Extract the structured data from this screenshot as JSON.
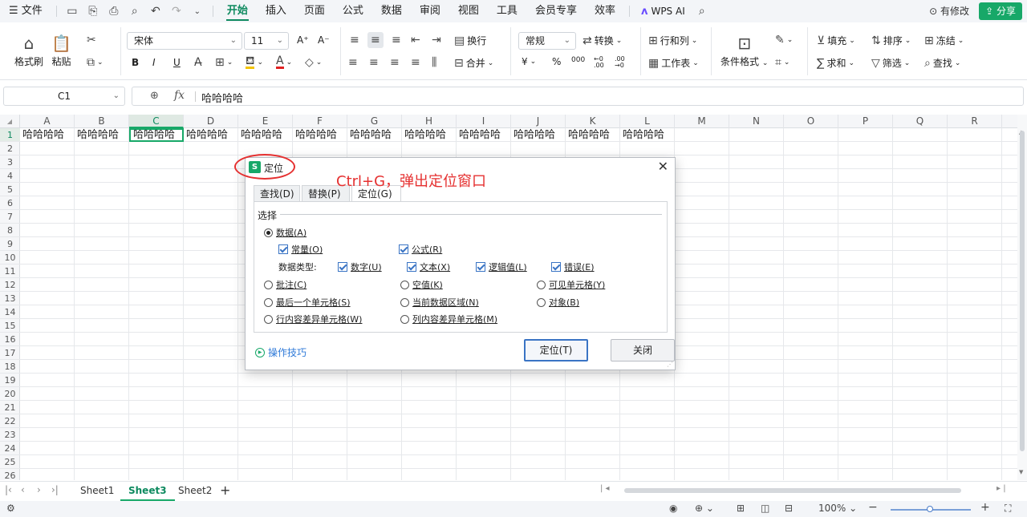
{
  "menubar": {
    "file": "文件",
    "tabs": [
      "开始",
      "插入",
      "页面",
      "公式",
      "数据",
      "审阅",
      "视图",
      "工具",
      "会员专享",
      "效率"
    ],
    "active_tab": "开始",
    "wps_ai": "WPS AI",
    "has_changes": "有修改",
    "share": "分享"
  },
  "ribbon": {
    "format_painter": "格式刷",
    "paste": "粘贴",
    "font_name": "宋体",
    "font_size": "11",
    "wrap": "换行",
    "merge": "合并",
    "number_format": "常规",
    "convert": "转换",
    "percent": "%",
    "row_col": "行和列",
    "worksheet": "工作表",
    "cond_format": "条件格式",
    "fill": "填充",
    "sort": "排序",
    "freeze": "冻结",
    "sum": "求和",
    "filter": "筛选",
    "find": "查找",
    "bold": "B",
    "italic": "I",
    "underline": "U",
    "font_grow": "A⁺",
    "font_shrink": "A⁻",
    "thousands": "000",
    "dec_inc": "←0 .00",
    "dec_dec": ".00 →0",
    "currency": "¥"
  },
  "formula_bar": {
    "cell_ref": "C1",
    "fx": "fx",
    "value": "哈哈哈哈"
  },
  "sheet": {
    "columns": [
      "A",
      "B",
      "C",
      "D",
      "E",
      "F",
      "G",
      "H",
      "I",
      "J",
      "K",
      "L",
      "M",
      "N",
      "O",
      "P",
      "Q",
      "R"
    ],
    "selected_column": "C",
    "rows": [
      "1",
      "2",
      "3",
      "4",
      "5",
      "6",
      "7",
      "8",
      "9",
      "10",
      "11",
      "12",
      "13",
      "14",
      "15",
      "16",
      "17",
      "18",
      "19",
      "20",
      "21",
      "22",
      "23",
      "24",
      "25",
      "26"
    ],
    "row1_values": [
      "哈哈哈哈",
      "哈哈哈哈",
      "哈哈哈哈",
      "哈哈哈哈",
      "哈哈哈哈",
      "哈哈哈哈",
      "哈哈哈哈",
      "哈哈哈哈",
      "哈哈哈哈",
      "哈哈哈哈",
      "哈哈哈哈",
      "哈哈哈哈"
    ],
    "active_cell_index": 2
  },
  "sheet_tabs": {
    "tabs": [
      "Sheet1",
      "Sheet3",
      "Sheet2"
    ],
    "active": "Sheet3",
    "add": "+"
  },
  "status": {
    "zoom": "100%",
    "minus": "−",
    "plus": "+"
  },
  "dialog": {
    "title": "定位",
    "logo": "S",
    "tabs": [
      "查找(D)",
      "替换(P)",
      "定位(G)"
    ],
    "active_tab": "定位(G)",
    "group_label": "选择",
    "data": "数据(A)",
    "constant": "常量(O)",
    "formula": "公式(R)",
    "data_type_label": "数据类型:",
    "number": "数字(U)",
    "text": "文本(X)",
    "logical": "逻辑值(L)",
    "error": "错误(E)",
    "comment": "批注(C)",
    "blank": "空值(K)",
    "visible_cells": "可见单元格(Y)",
    "last_cell": "最后一个单元格(S)",
    "current_region": "当前数据区域(N)",
    "object": "对象(B)",
    "row_diff": "行内容差异单元格(W)",
    "col_diff": "列内容差异单元格(M)",
    "tips": "操作技巧",
    "locate_btn": "定位(T)",
    "close_btn": "关闭"
  },
  "annotation": {
    "text": "Ctrl+G，弹出定位窗口",
    "color": "#e53030"
  },
  "colors": {
    "accent": "#17a868",
    "primary_border": "#3a74c4"
  }
}
